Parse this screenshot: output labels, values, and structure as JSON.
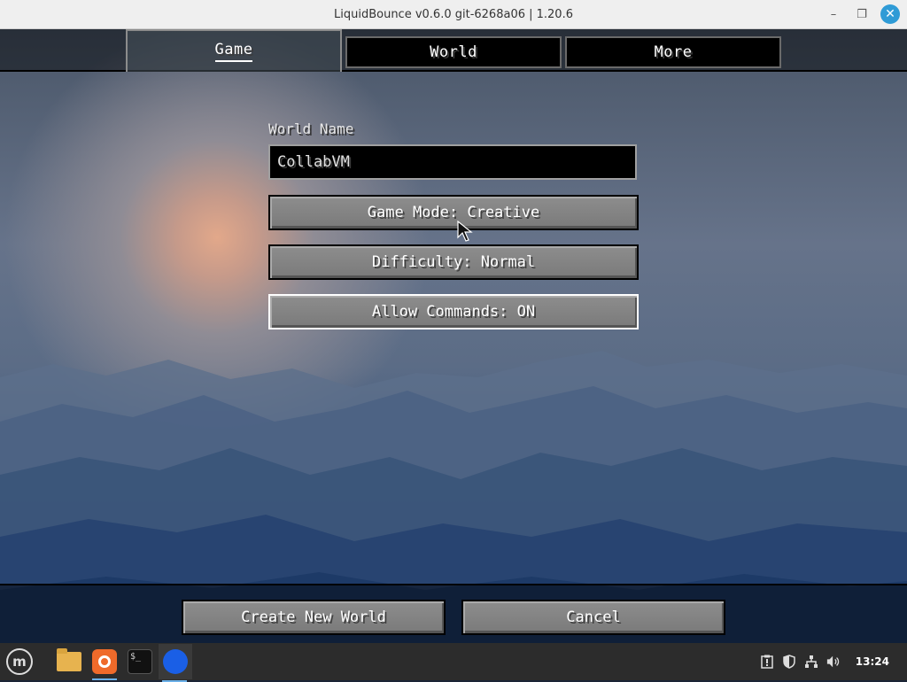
{
  "window": {
    "title": "LiquidBounce v0.6.0 git-6268a06 | 1.20.6",
    "minimize": "–",
    "maximize": "❐",
    "close": "✕"
  },
  "tabs": [
    {
      "label": "Game",
      "active": true
    },
    {
      "label": "World",
      "active": false
    },
    {
      "label": "More",
      "active": false
    }
  ],
  "form": {
    "world_name_label": "World Name",
    "world_name_value": "CollabVM",
    "game_mode": "Game Mode: Creative",
    "difficulty": "Difficulty: Normal",
    "allow_commands": "Allow Commands: ON"
  },
  "footer": {
    "create_label": "Create New World",
    "cancel_label": "Cancel"
  },
  "taskbar": {
    "menu_icon": "m",
    "terminal_prompt": "$_",
    "tray": {
      "clock": "13:24"
    }
  },
  "colors": {
    "button_face": "#7f7f7f",
    "field_bg": "#000000",
    "taskbar_bg": "#2c2c2c",
    "accent_close": "#2f9bd6"
  }
}
